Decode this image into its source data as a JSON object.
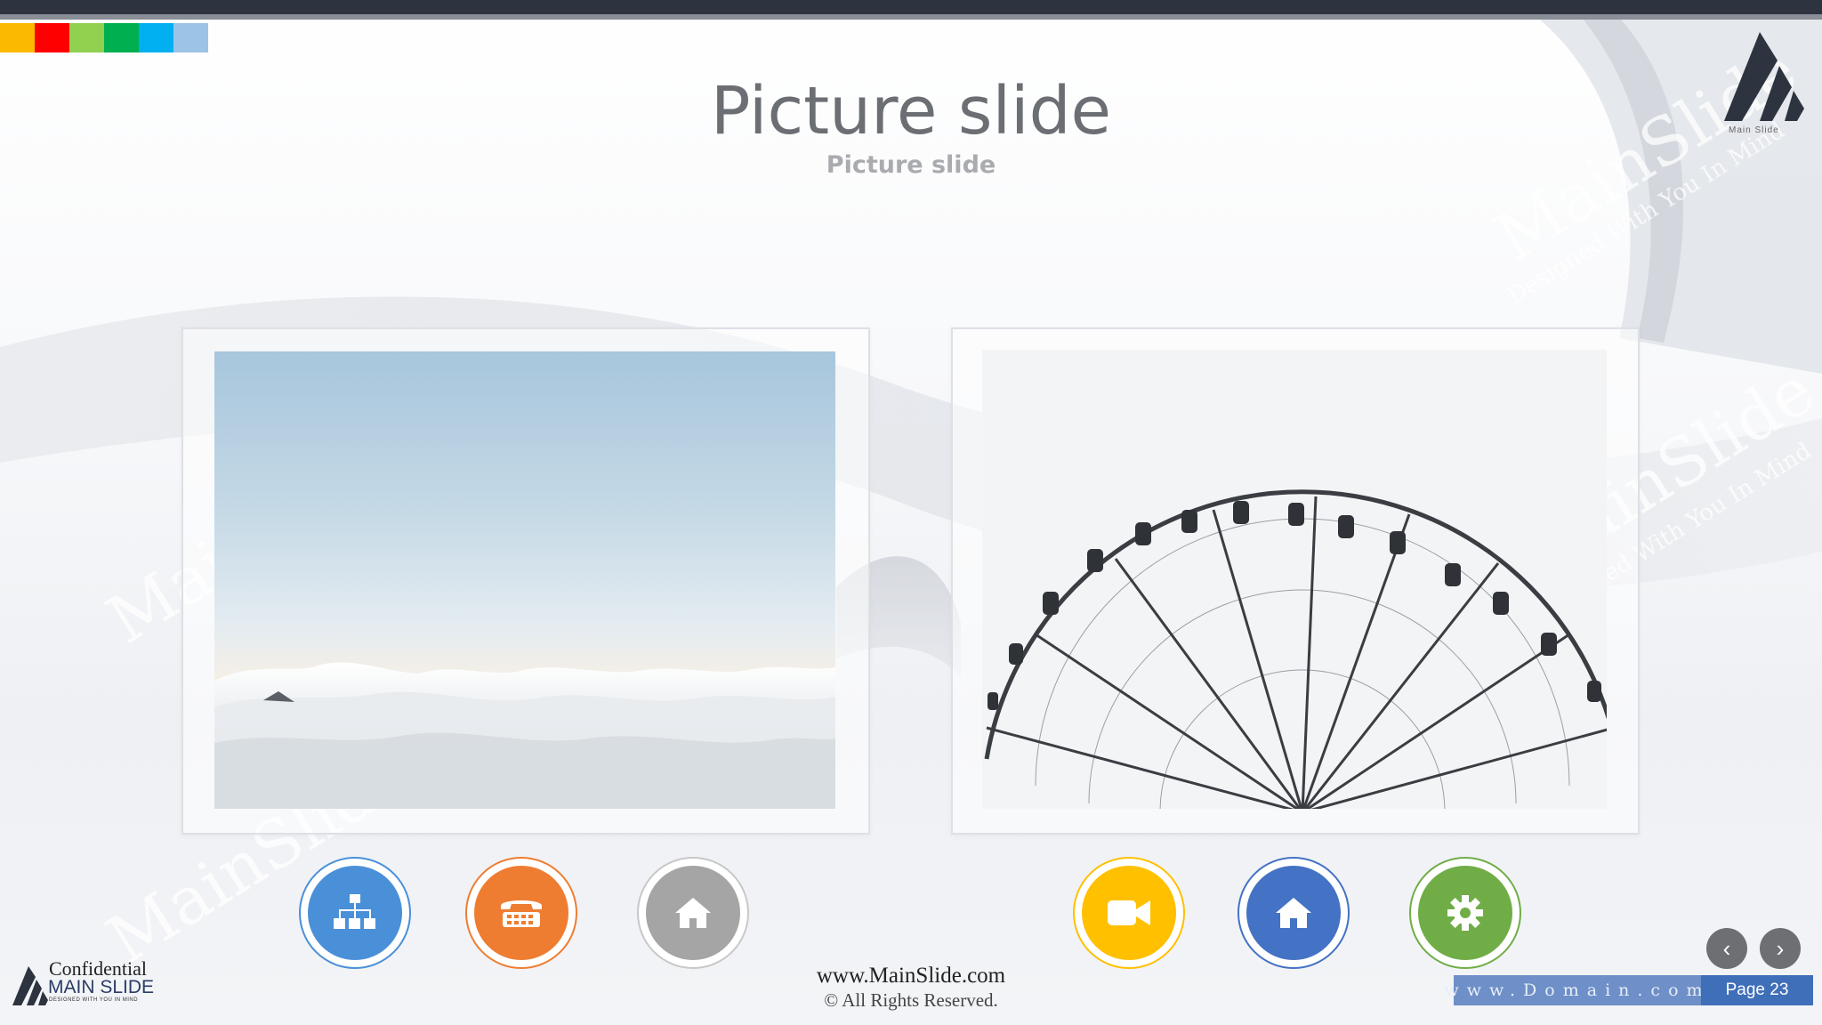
{
  "slide": {
    "title": "Picture slide",
    "subtitle": "Picture slide"
  },
  "colors": {
    "swatches": [
      "#fbb900",
      "#ff0000",
      "#92d050",
      "#00b050",
      "#00b0f0",
      "#9dc3e6"
    ],
    "accent_blue": "#4a90d9",
    "accent_orange": "#ee7d31",
    "accent_gray": "#a5a5a5",
    "accent_yellow": "#ffc000",
    "accent_royal": "#4472c4",
    "accent_green": "#70ad47"
  },
  "logo_top_right": {
    "text": "Main Slide",
    "icon": "main-slide-logo-icon"
  },
  "watermark": {
    "brand": "MainSlide",
    "tagline": "Designed With You In Mind"
  },
  "pictures": [
    {
      "name": "clouds-picture"
    },
    {
      "name": "ferris-wheel-picture"
    }
  ],
  "icon_buttons_left": [
    {
      "icon": "org-chart-icon",
      "color": "#4a90d9"
    },
    {
      "icon": "telephone-icon",
      "color": "#ee7d31"
    },
    {
      "icon": "home-icon",
      "color": "#a5a5a5"
    }
  ],
  "icon_buttons_right": [
    {
      "icon": "video-camera-icon",
      "color": "#ffc000"
    },
    {
      "icon": "home-icon",
      "color": "#4472c4"
    },
    {
      "icon": "gear-icon",
      "color": "#70ad47"
    }
  ],
  "nav": {
    "prev": "‹",
    "next": "›"
  },
  "footer": {
    "url": "www.MainSlide.com",
    "rights": "© All Rights Reserved.",
    "domain": "www.Domain.com",
    "page": "Page 23",
    "confidential": "Confidential",
    "brand": "MAIN SLIDE",
    "tagline": "DESIGNED WITH YOU IN MIND"
  }
}
